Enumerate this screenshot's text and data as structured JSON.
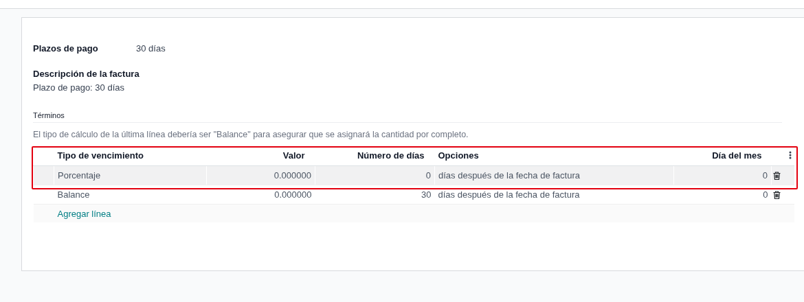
{
  "fields": [
    {
      "label": "Plazos de pago",
      "value": "30 días"
    }
  ],
  "description": {
    "label": "Descripción de la factura",
    "value": "Plazo de pago: 30 días"
  },
  "terms": {
    "title": "Términos",
    "hint": "El tipo de cálculo de la última línea debería ser \"Balance\" para asegurar que se asignará la cantidad por completo.",
    "columns": [
      "Tipo de vencimiento",
      "Valor",
      "Número de días",
      "Opciones",
      "Día del mes"
    ],
    "rows": [
      {
        "type": "Porcentaje",
        "value": "0.000000",
        "days": "0",
        "option": "días después de la fecha de factura",
        "day_of_month": "0",
        "hovered": true
      },
      {
        "type": "Balance",
        "value": "0.000000",
        "days": "30",
        "option": "días después de la fecha de factura",
        "day_of_month": "0",
        "hovered": false
      }
    ],
    "highlight_frame": true,
    "add_line": "Agregar línea"
  }
}
